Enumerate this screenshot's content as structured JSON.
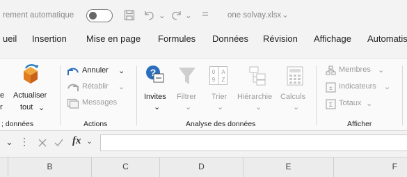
{
  "titlebar": {
    "autosave_label": "rement automatique",
    "filename": "one solvay.xlsx",
    "filename_chevron": "⌄",
    "icons": [
      "save-icon",
      "undo-icon",
      "redo-icon",
      "customize-quick-access-icon"
    ]
  },
  "tabs": [
    "ueil",
    "Insertion",
    "Mise en page",
    "Formules",
    "Données",
    "Révision",
    "Affichage",
    "Automatis"
  ],
  "ribbon": {
    "actualiser": {
      "line1": "Actualiser",
      "line2": "tout",
      "left_cut1": "e",
      "left_cut2": "r"
    },
    "group_left_cut": "; données",
    "actions": {
      "annuler": "Annuler",
      "retablir": "Rétablir",
      "messages": "Messages",
      "group": "Actions"
    },
    "analyse": {
      "invites": "Invites",
      "filtrer": "Filtrer",
      "trier": "Trier",
      "hierarchie": "Hiérarchie",
      "calculs": "Calculs",
      "group": "Analyse des données"
    },
    "afficher": {
      "membres": "Membres",
      "indicateurs": "Indicateurs",
      "totaux": "Totaux",
      "group": "Afficher"
    }
  },
  "formula_bar": {
    "fx": "fx",
    "value": ""
  },
  "columns": [
    "B",
    "C",
    "D",
    "E",
    "F"
  ]
}
